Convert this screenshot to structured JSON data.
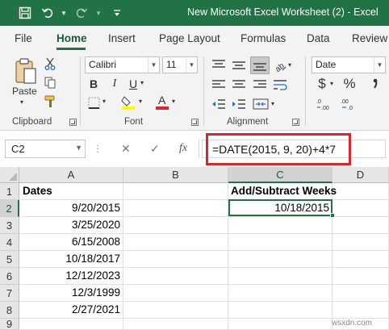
{
  "window": {
    "title": "New Microsoft Excel Worksheet (2)  -  Excel",
    "quick_access": [
      "save-icon",
      "undo-icon",
      "redo-icon",
      "customize-icon"
    ]
  },
  "tabs": [
    "File",
    "Home",
    "Insert",
    "Page Layout",
    "Formulas",
    "Data",
    "Review"
  ],
  "active_tab": "Home",
  "ribbon": {
    "clipboard": {
      "label": "Clipboard",
      "paste_label": "Paste"
    },
    "font": {
      "label": "Font",
      "font_name": "Calibri",
      "font_size": "11",
      "bold": "B",
      "italic": "I",
      "underline": "U"
    },
    "alignment": {
      "label": "Alignment"
    },
    "number": {
      "format": "Date",
      "currency": "$",
      "percent": "%"
    }
  },
  "formula_bar": {
    "name_box": "C2",
    "cancel": "✕",
    "enter": "✓",
    "fx": "fx",
    "formula": "=DATE(2015, 9, 20)+4*7"
  },
  "sheet": {
    "columns": [
      "A",
      "B",
      "C",
      "D"
    ],
    "selected_column": "C",
    "rows": [
      "1",
      "2",
      "3",
      "4",
      "5",
      "6",
      "7",
      "8",
      "9"
    ],
    "selected_row": "2",
    "a_header": "Dates",
    "c_header": "Add/Subtract Weeks",
    "a_values": [
      "9/20/2015",
      "3/25/2020",
      "6/15/2008",
      "10/18/2017",
      "12/12/2023",
      "12/3/1999",
      "2/27/2021"
    ],
    "c2_value": "10/18/2015"
  },
  "watermark": "wsxdn.com",
  "colors": {
    "accent": "#217346",
    "highlight": "#e0242a"
  }
}
